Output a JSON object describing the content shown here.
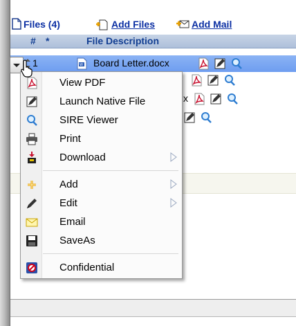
{
  "toolbar": {
    "files_label": "Files (4)",
    "add_files_label": "Add Files",
    "add_mail_label": "Add Mail"
  },
  "grid": {
    "headers": {
      "num": "#",
      "star": "*",
      "description": "File Description"
    },
    "rows": [
      {
        "num": "1",
        "name": "Board Letter.docx",
        "name_fragment": ""
      },
      {
        "num": "",
        "name": "",
        "name_fragment": ""
      },
      {
        "num": "",
        "name": "",
        "name_fragment": "x"
      },
      {
        "num": "",
        "name": "",
        "name_fragment": ""
      }
    ]
  },
  "context_menu": {
    "items": [
      {
        "label": "View PDF",
        "icon": "pdf-icon",
        "submenu": false
      },
      {
        "label": "Launch Native File",
        "icon": "pencil-icon",
        "submenu": false
      },
      {
        "label": "SIRE Viewer",
        "icon": "magnifier-icon",
        "submenu": false
      },
      {
        "label": "Print",
        "icon": "printer-icon",
        "submenu": false
      },
      {
        "label": "Download",
        "icon": "download-icon",
        "submenu": true
      },
      {
        "label": "Add",
        "icon": "add-icon",
        "submenu": true
      },
      {
        "label": "Edit",
        "icon": "edit-pencil-icon",
        "submenu": true
      },
      {
        "label": "Email",
        "icon": "envelope-icon",
        "submenu": false
      },
      {
        "label": "SaveAs",
        "icon": "floppy-disk-icon",
        "submenu": false
      },
      {
        "label": "Confidential",
        "icon": "confidential-icon",
        "submenu": false
      }
    ]
  },
  "colors": {
    "link": "#0b2fa3",
    "header_bg": "#b8c7df",
    "selected_row": "#7aa7f2",
    "pdf_red": "#c8102e"
  }
}
